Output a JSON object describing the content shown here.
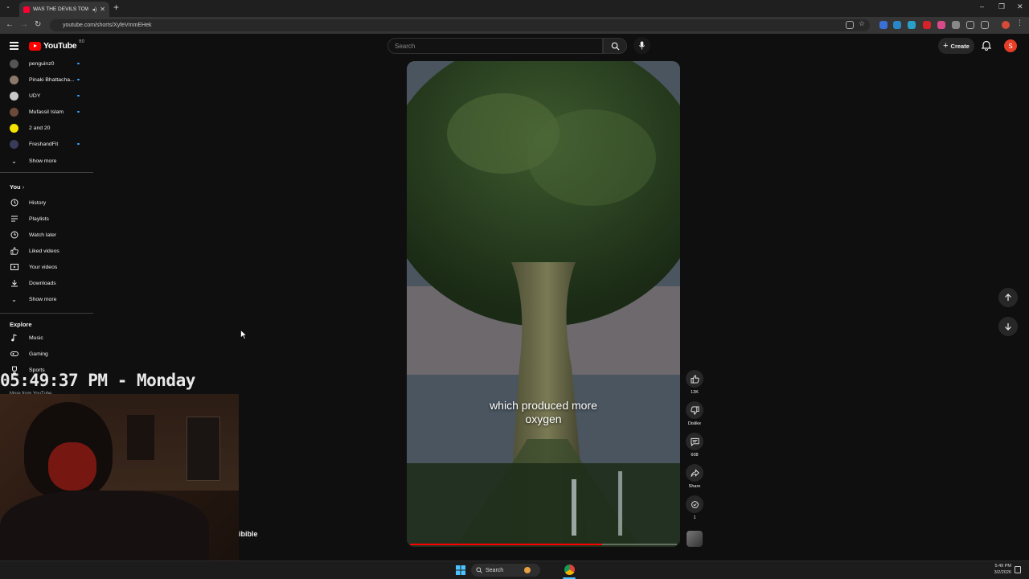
{
  "browser": {
    "tab_title": "WAS THE DEVILS TOWER A",
    "url": "youtube.com/shorts/XyfeVmmEHek",
    "new_tab": "+",
    "tab_close": "✕"
  },
  "masthead": {
    "logo_text": "YouTube",
    "country_code": "BD",
    "search_placeholder": "Search",
    "create_label": "Create",
    "avatar_letter": "S"
  },
  "sidebar": {
    "subscriptions": [
      {
        "label": "penguinz0",
        "color": "#555555",
        "live": true
      },
      {
        "label": "Pinaki Bhattacha...",
        "color": "#8a7a6a",
        "live": true
      },
      {
        "label": "UDY",
        "color": "#c9c9c9",
        "live": true
      },
      {
        "label": "Mufassil Islam",
        "color": "#6b4a3a",
        "live": true
      },
      {
        "label": "2 and 20",
        "color": "#f4e400",
        "live": false
      },
      {
        "label": "FreshandFit",
        "color": "#3a3a5a",
        "live": true
      }
    ],
    "show_more_1": "Show more",
    "you_heading": "You",
    "you_items": [
      {
        "label": "History",
        "icon": "history-icon"
      },
      {
        "label": "Playlists",
        "icon": "playlists-icon"
      },
      {
        "label": "Watch later",
        "icon": "watch-later-icon"
      },
      {
        "label": "Liked videos",
        "icon": "liked-icon"
      },
      {
        "label": "Your videos",
        "icon": "your-videos-icon"
      },
      {
        "label": "Downloads",
        "icon": "download-icon"
      }
    ],
    "show_more_2": "Show more",
    "explore_heading": "Explore",
    "explore_items": [
      {
        "label": "Music",
        "icon": "music-icon"
      },
      {
        "label": "Gaming",
        "icon": "gaming-icon"
      },
      {
        "label": "Sports",
        "icon": "sports-icon"
      }
    ],
    "more_from": "More from YouTube"
  },
  "overlay": {
    "clock": "05:49:37 PM - Monday",
    "audible": "ibible"
  },
  "video": {
    "caption_line1": "which produced more",
    "caption_line2": "oxygen",
    "progress": 0.72
  },
  "actions": {
    "likes": "13K",
    "dislike": "Dislike",
    "comments": "608",
    "share": "Share",
    "remix": "1"
  },
  "taskbar": {
    "search_label": "Search",
    "time": "5:49 PM",
    "date": "3/2/2026"
  }
}
